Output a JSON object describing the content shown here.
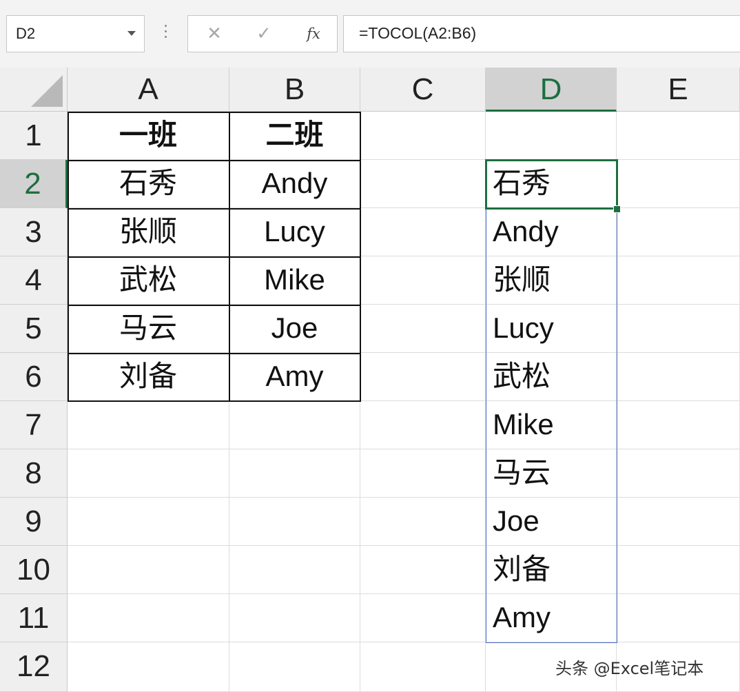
{
  "name_box": {
    "value": "D2"
  },
  "formula_bar": {
    "cancel_icon": "✕",
    "enter_icon": "✓",
    "fx_label": "fx",
    "formula": "=TOCOL(A2:B6)"
  },
  "columns": [
    "A",
    "B",
    "C",
    "D",
    "E"
  ],
  "rows": [
    "1",
    "2",
    "3",
    "4",
    "5",
    "6",
    "7",
    "8",
    "9",
    "10",
    "11",
    "12"
  ],
  "selected_cell": "D2",
  "cells": {
    "A1": "一班",
    "B1": "二班",
    "A2": "石秀",
    "B2": "Andy",
    "A3": "张顺",
    "B3": "Lucy",
    "A4": "武松",
    "B4": "Mike",
    "A5": "马云",
    "B5": "Joe",
    "A6": "刘备",
    "B6": "Amy",
    "D2": "石秀",
    "D3": "Andy",
    "D4": "张顺",
    "D5": "Lucy",
    "D6": "武松",
    "D7": "Mike",
    "D8": "马云",
    "D9": "Joe",
    "D10": "刘备",
    "D11": "Amy"
  },
  "colors": {
    "accent_green": "#1e6e41",
    "spill_blue": "#4a6fc8"
  },
  "watermark": "头条 @Excel笔记本"
}
